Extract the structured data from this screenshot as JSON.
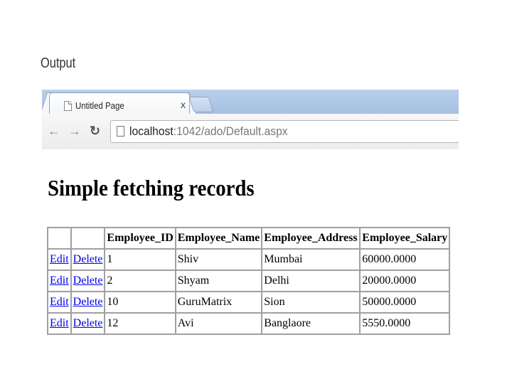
{
  "slide": {
    "title": "Output"
  },
  "browser": {
    "tab": {
      "title": "Untitled Page",
      "close": "x"
    },
    "url": {
      "host": "localhost",
      "rest": ":1042/ado/Default.aspx"
    }
  },
  "page": {
    "heading": "Simple fetching records",
    "table": {
      "headers": [
        "",
        "",
        "Employee_ID",
        "Employee_Name",
        "Employee_Address",
        "Employee_Salary"
      ],
      "edit_label": "Edit",
      "delete_label": "Delete",
      "rows": [
        {
          "id": "1",
          "name": "Shiv",
          "address": "Mumbai",
          "salary": "60000.0000"
        },
        {
          "id": "2",
          "name": "Shyam",
          "address": "Delhi",
          "salary": "20000.0000"
        },
        {
          "id": "10",
          "name": "GuruMatrix",
          "address": "Sion",
          "salary": "50000.0000"
        },
        {
          "id": "12",
          "name": "Avi",
          "address": "Banglaore",
          "salary": "5550.0000"
        }
      ]
    }
  }
}
